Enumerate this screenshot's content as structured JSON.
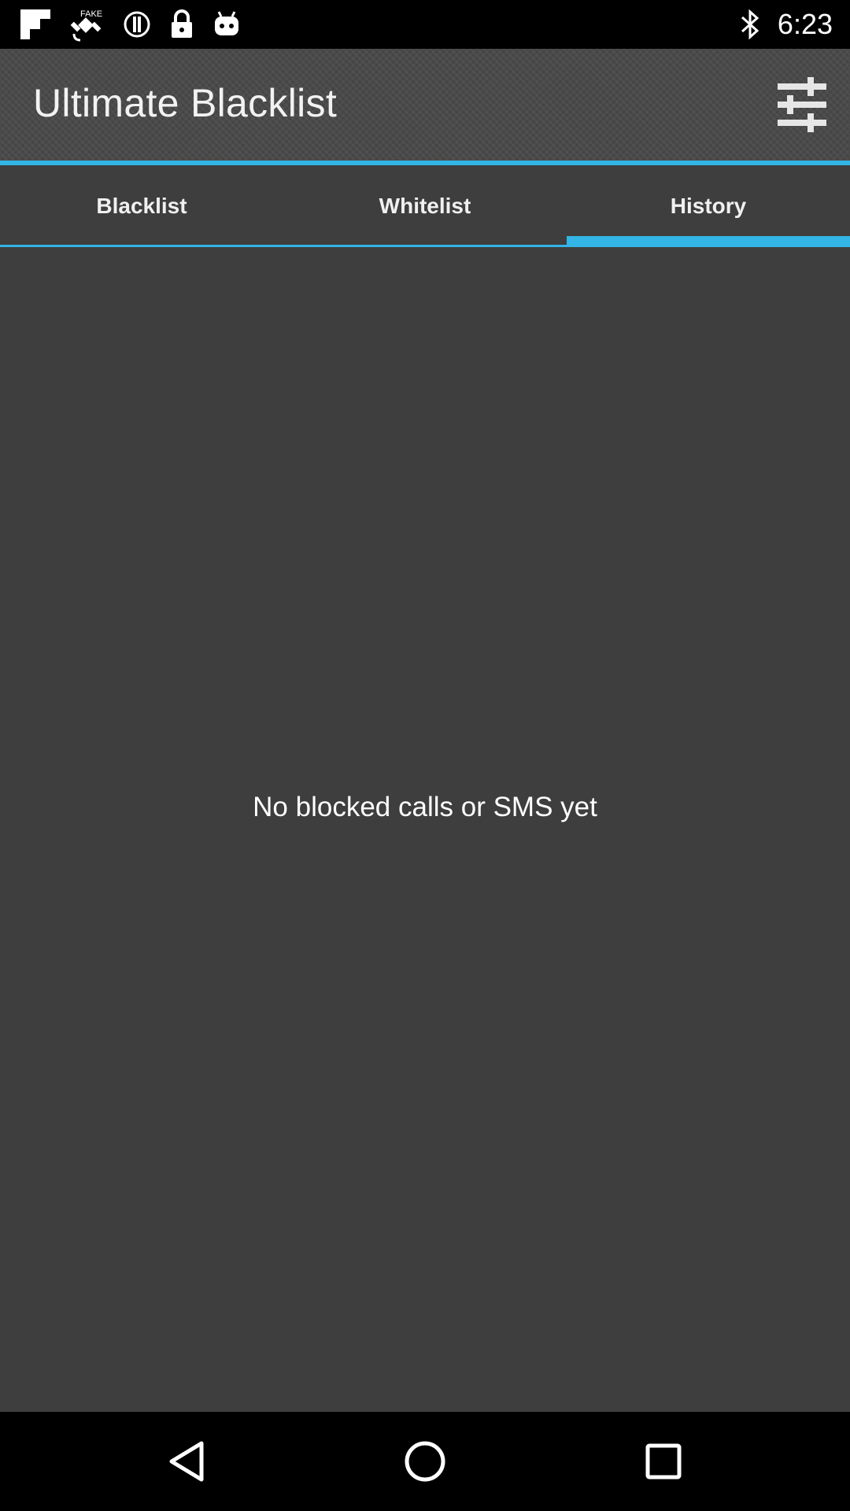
{
  "status_bar": {
    "time": "6:23",
    "left_icons": [
      "flipboard-icon",
      "fake-gps-icon",
      "sync-circle-icon",
      "lock-icon",
      "android-icon"
    ],
    "right_icons": [
      "bluetooth-icon"
    ]
  },
  "app_bar": {
    "title": "Ultimate Blacklist",
    "settings_icon": "sliders-icon"
  },
  "tabs": [
    {
      "label": "Blacklist",
      "active": false
    },
    {
      "label": "Whitelist",
      "active": false
    },
    {
      "label": "History",
      "active": true
    }
  ],
  "content": {
    "empty_message": "No blocked calls or SMS yet"
  },
  "nav_bar": {
    "buttons": [
      "back",
      "home",
      "recents"
    ]
  },
  "colors": {
    "accent": "#33b5e5",
    "background": "#3e3e3e",
    "app_bar": "#4a4a4a",
    "status_bar": "#000000"
  }
}
